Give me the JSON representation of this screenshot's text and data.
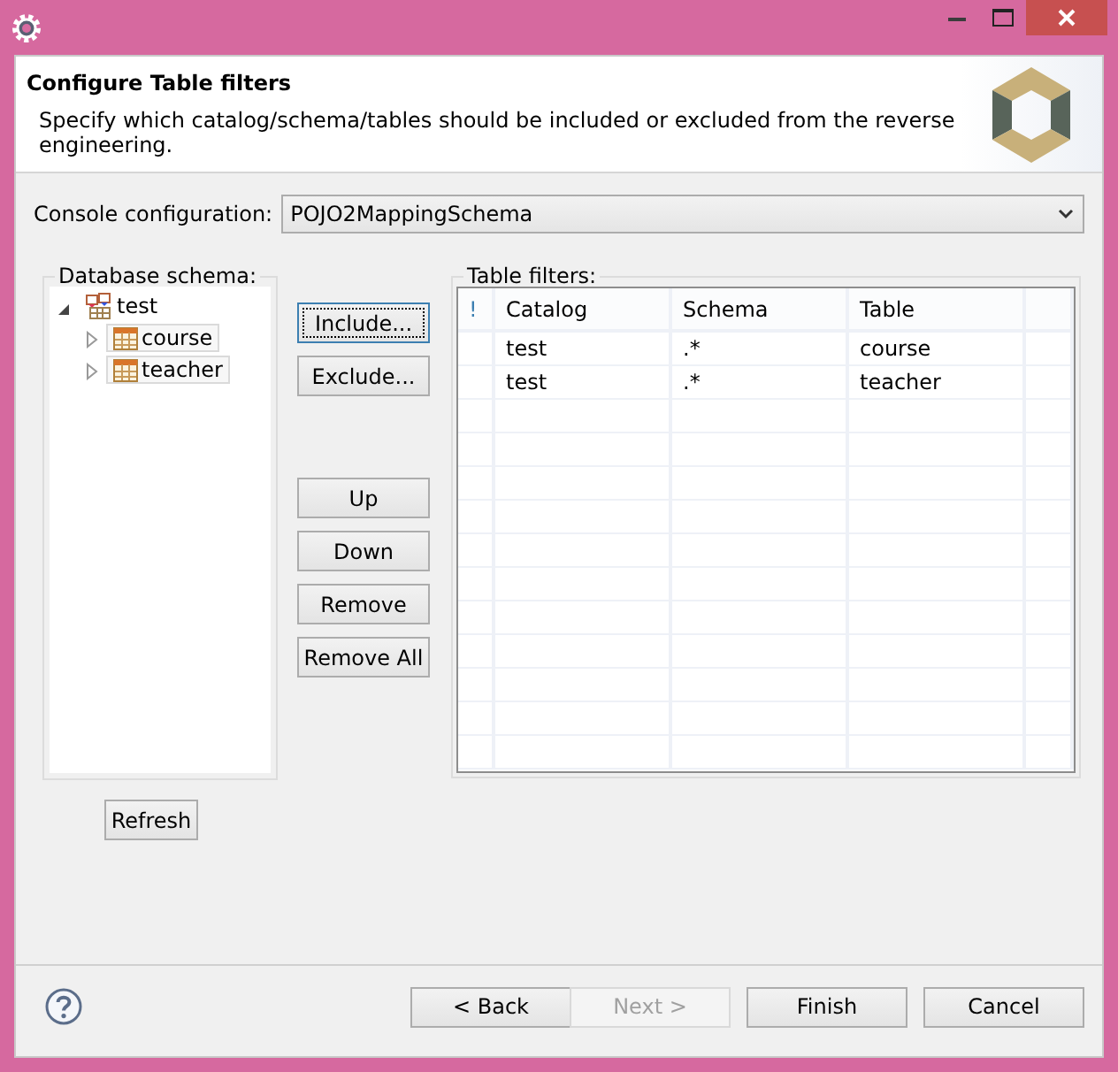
{
  "header": {
    "title": "Configure Table filters",
    "description": "Specify which catalog/schema/tables should be included or excluded from the reverse engineering."
  },
  "console_configuration": {
    "label": "Console configuration:",
    "value": "POJO2MappingSchema"
  },
  "database_schema": {
    "label": "Database schema:",
    "tree": [
      {
        "label": "test",
        "kind": "schema",
        "expanded": true,
        "children": [
          {
            "label": "course",
            "kind": "table",
            "expanded": false
          },
          {
            "label": "teacher",
            "kind": "table",
            "expanded": false
          }
        ]
      }
    ]
  },
  "actions": [
    {
      "label": "Include...",
      "focused": true
    },
    {
      "label": "Exclude...",
      "focused": false
    },
    {
      "label": "Up",
      "focused": false
    },
    {
      "label": "Down",
      "focused": false
    },
    {
      "label": "Remove",
      "focused": false
    },
    {
      "label": "Remove All",
      "focused": false
    }
  ],
  "refresh": {
    "label": "Refresh"
  },
  "table_filters": {
    "label": "Table filters:",
    "columns": [
      "!",
      "Catalog",
      "Schema",
      "Table"
    ],
    "rows": [
      [
        "",
        "test",
        ".*",
        "course"
      ],
      [
        "",
        "test",
        ".*",
        "teacher"
      ]
    ]
  },
  "footer": {
    "buttons": [
      {
        "label": "< Back",
        "disabled": false
      },
      {
        "label": "Next >",
        "disabled": true
      },
      {
        "label": "Finish",
        "disabled": false
      },
      {
        "label": "Cancel",
        "disabled": false
      }
    ]
  }
}
